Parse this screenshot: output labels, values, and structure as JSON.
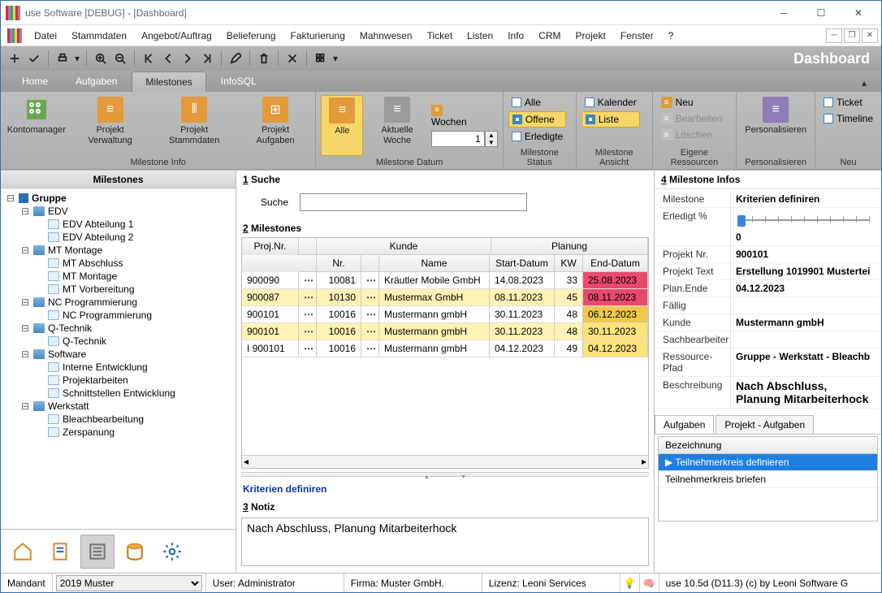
{
  "window": {
    "title": "use Software [DEBUG] - [Dashboard]",
    "toolbar_title": "Dashboard"
  },
  "menu": [
    "Datei",
    "Stammdaten",
    "Angebot/Auftrag",
    "Belieferung",
    "Fakturierung",
    "Mahnwesen",
    "Ticket",
    "Listen",
    "Info",
    "CRM",
    "Projekt",
    "Fenster",
    "?"
  ],
  "ribtabs": {
    "items": [
      "Home",
      "Aufgaben",
      "Milestones",
      "InfoSQL"
    ],
    "active": "Milestones"
  },
  "ribbon": {
    "g1": {
      "caption": "Milestone Info",
      "items": [
        "Kontomanager",
        "Projekt\nVerwaltung",
        "Projekt\nStammdaten",
        "Projekt\nAufgaben"
      ]
    },
    "g2": {
      "caption": "Milestone Datum",
      "alle": "Alle",
      "aktw": "Aktuelle\nWoche",
      "wochen": "Wochen",
      "spin": "1"
    },
    "g3": {
      "caption": "Milestone Status",
      "alle": "Alle",
      "offene": "Offene",
      "erledigte": "Erledigte"
    },
    "g4": {
      "caption": "Milestone Ansicht",
      "kal": "Kalender",
      "liste": "Liste"
    },
    "g5": {
      "caption": "Eigene Ressourcen",
      "neu": "Neu",
      "bearb": "Bearbeiten",
      "loesch": "Löschen"
    },
    "g6": {
      "caption": "Personalisieren",
      "btn": "Personalisieren"
    },
    "g7": {
      "caption": "Neu",
      "ticket": "Ticket",
      "timeline": "Timeline"
    }
  },
  "tree": {
    "title": "Milestones",
    "root": "Gruppe",
    "nodes": [
      {
        "l": "EDV",
        "c": [
          {
            "l": "EDV Abteilung 1"
          },
          {
            "l": "EDV Abteilung 2"
          }
        ]
      },
      {
        "l": "MT Montage",
        "c": [
          {
            "l": "MT Abschluss"
          },
          {
            "l": "MT Montage"
          },
          {
            "l": "MT Vorbereitung"
          }
        ]
      },
      {
        "l": "NC Programmierung",
        "c": [
          {
            "l": "NC Programmierung"
          }
        ]
      },
      {
        "l": "Q-Technik",
        "c": [
          {
            "l": "Q-Technik"
          }
        ]
      },
      {
        "l": "Software",
        "c": [
          {
            "l": "Interne Entwicklung"
          },
          {
            "l": "Projektarbeiten"
          },
          {
            "l": "Schnittstellen Entwicklung"
          }
        ]
      },
      {
        "l": "Werkstatt",
        "c": [
          {
            "l": "Bleachbearbeitung"
          },
          {
            "l": "Zerspanung"
          }
        ]
      }
    ]
  },
  "search": {
    "hdr": "1 Suche",
    "lbl": "Suche",
    "val": ""
  },
  "grid": {
    "hdr": "2 Milestones",
    "group_kunde": "Kunde",
    "group_planung": "Planung",
    "cols": {
      "proj": "Proj.Nr.",
      "nr": "Nr.",
      "name": "Name",
      "sd": "Start-Datum",
      "kw": "KW",
      "ed": "End-Datum"
    },
    "rows": [
      {
        "proj": "900090",
        "nr": "10081",
        "name": "Kräutler Mobile GmbH",
        "sd": "14.08.2023",
        "kw": "33",
        "ed": "25.08.2023",
        "edcls": "hl-red"
      },
      {
        "proj": "900087",
        "nr": "10130",
        "name": "Mustermax GmbH",
        "sd": "08.11.2023",
        "kw": "45",
        "ed": "08.11.2023",
        "edcls": "hl-red",
        "rowcls": "hl-yellow"
      },
      {
        "proj": "900101",
        "nr": "10016",
        "name": "Mustermann gmbH",
        "sd": "30.11.2023",
        "kw": "48",
        "ed": "06.12.2023",
        "edcls": "hl-amber"
      },
      {
        "proj": "900101",
        "nr": "10016",
        "name": "Mustermann gmbH",
        "sd": "30.11.2023",
        "kw": "48",
        "ed": "30.11.2023",
        "edcls": "hl-yellow2",
        "rowcls": "hl-yellow"
      },
      {
        "proj": "900101",
        "nr": "10016",
        "name": "Mustermann gmbH",
        "sd": "04.12.2023",
        "kw": "49",
        "ed": "04.12.2023",
        "edcls": "hl-yellow2"
      }
    ]
  },
  "subtitle": "Kriterien definiren",
  "notiz": {
    "hdr": "3 Notiz",
    "text": "Nach Abschluss, Planung Mitarbeiterhock"
  },
  "info": {
    "hdr": "4 Milestone Infos",
    "milestone_l": "Milestone",
    "milestone_v": "Kriterien definiren",
    "erl_l": "Erledigt %",
    "erl_v": "0",
    "pn_l": "Projekt Nr.",
    "pn_v": "900101",
    "pt_l": "Projekt Text",
    "pt_v": "Erstellung 1019901 Mustertei",
    "pe_l": "Plan.Ende",
    "pe_v": "04.12.2023",
    "fl_l": "Fällig",
    "fl_v": "",
    "kd_l": "Kunde",
    "kd_v": "Mustermann gmbH",
    "sb_l": "Sachbearbeiter",
    "sb_v": "",
    "rp_l": "Ressource-Pfad",
    "rp_v": "Gruppe - Werkstatt - Bleachb",
    "bs_l": "Beschreibung",
    "bs_v": "Nach Abschluss, Planung Mitarbeiterhock"
  },
  "subtabs": {
    "a": "Aufgaben",
    "b": "Projekt - Aufgaben",
    "hdr": "Bezeichnung",
    "items": [
      "Teilnehmerkreis definieren",
      "Teilnehmerkreis briefen"
    ],
    "sel": 0
  },
  "status": {
    "mandant_l": "Mandant",
    "mandant_v": "2019 Muster",
    "user": "User: Administrator",
    "firma": "Firma: Muster GmbH.",
    "lizenz": "Lizenz: Leoni Services",
    "ver": "use 10.5d (D11.3) (c) by Leoni Software G"
  }
}
